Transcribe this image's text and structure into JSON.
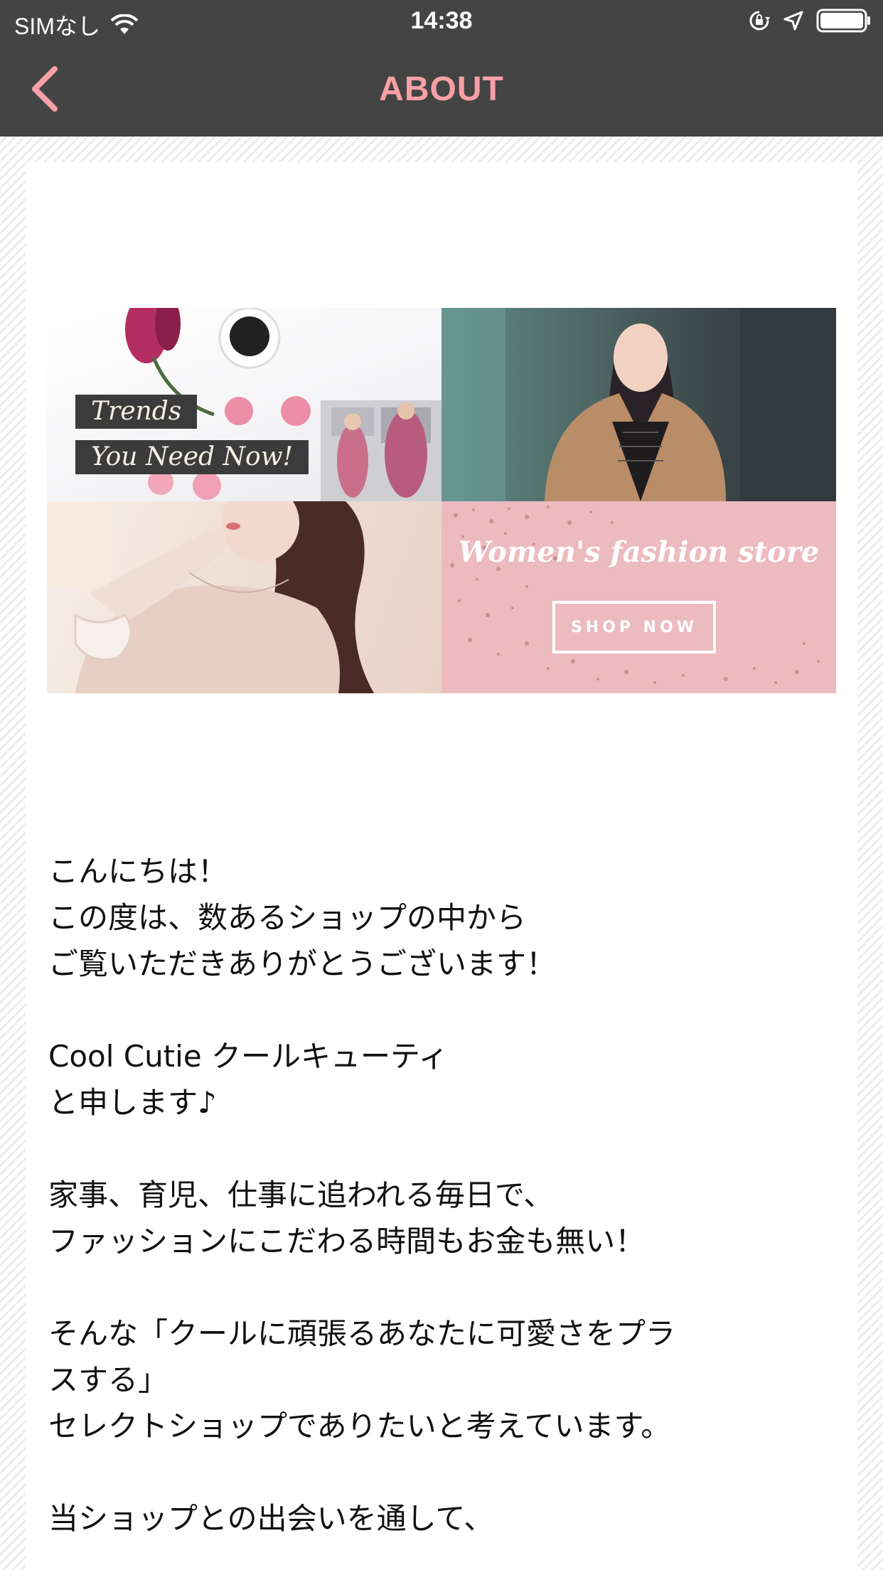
{
  "status_bar": {
    "carrier": "SIMなし",
    "time": "14:38",
    "icons": [
      "wifi-icon",
      "rotation-lock-icon",
      "location-arrow-icon",
      "battery-icon"
    ]
  },
  "nav": {
    "title": "ABOUT",
    "back_icon": "chevron-left-icon",
    "accent_color": "#f7a0a5",
    "bar_color": "#444444"
  },
  "banner": {
    "trends_line1": "Trends",
    "trends_line2": "You Need Now!",
    "store_title": "Women's fashion store",
    "shop_now": "SHOP NOW"
  },
  "intro": {
    "lines": [
      "こんにちは！",
      "この度は、数あるショップの中から",
      "ご覧いただきありがとうございます！",
      "",
      "Cool Cutie クールキューティ",
      "と申します♪",
      "",
      "家事、育児、仕事に追われる毎日で、",
      "ファッションにこだわる時間もお金も無い！",
      "",
      "そんな「クールに頑張るあなたに可愛さをプラ",
      "スする」",
      "セレクトショップでありたいと考えています。",
      "",
      "当ショップとの出会いを通して、"
    ]
  }
}
